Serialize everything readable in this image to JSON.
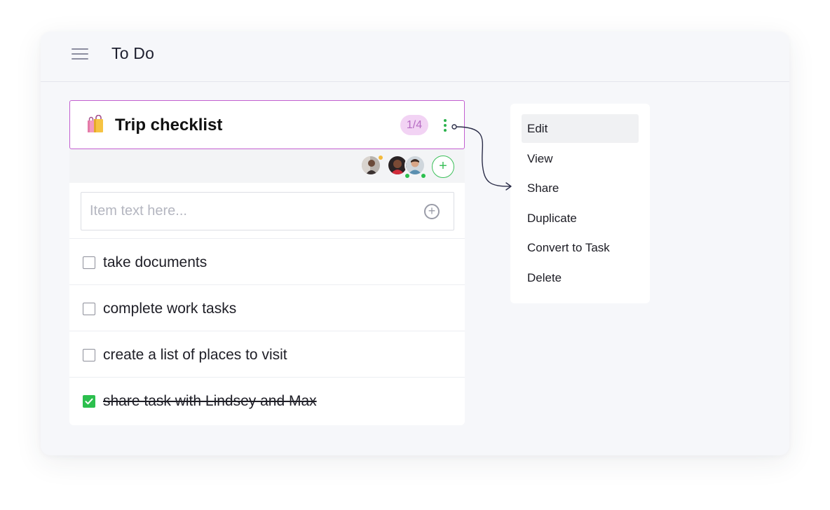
{
  "header": {
    "title": "To Do",
    "menu_icon": "hamburger-icon"
  },
  "checklist": {
    "icon": "shopping-bag-icon",
    "title": "Trip checklist",
    "progress": "1/4",
    "completed": 1,
    "total": 4,
    "accent_color": "#c25fd0",
    "input": {
      "placeholder": "Item text here..."
    },
    "members": [
      {
        "name": "member-1",
        "status_color": "#f3b93c"
      },
      {
        "name": "member-2",
        "status_color": "#2cbf4e"
      },
      {
        "name": "member-3",
        "status_color": "#2cbf4e"
      }
    ],
    "items": [
      {
        "label": "take documents",
        "checked": false
      },
      {
        "label": "complete work tasks",
        "checked": false
      },
      {
        "label": "create a list of places to visit",
        "checked": false
      },
      {
        "label": "share task with Lindsey and Max",
        "checked": true
      }
    ]
  },
  "context_menu": {
    "items": [
      {
        "label": "Edit",
        "active": true
      },
      {
        "label": "View",
        "active": false
      },
      {
        "label": "Share",
        "active": false
      },
      {
        "label": "Duplicate",
        "active": false
      },
      {
        "label": "Convert to Task",
        "active": false
      },
      {
        "label": "Delete",
        "active": false
      }
    ]
  },
  "colors": {
    "check_green": "#2cbf4e",
    "badge_bg": "#f2d3f4",
    "badge_text": "#b66bc3"
  }
}
